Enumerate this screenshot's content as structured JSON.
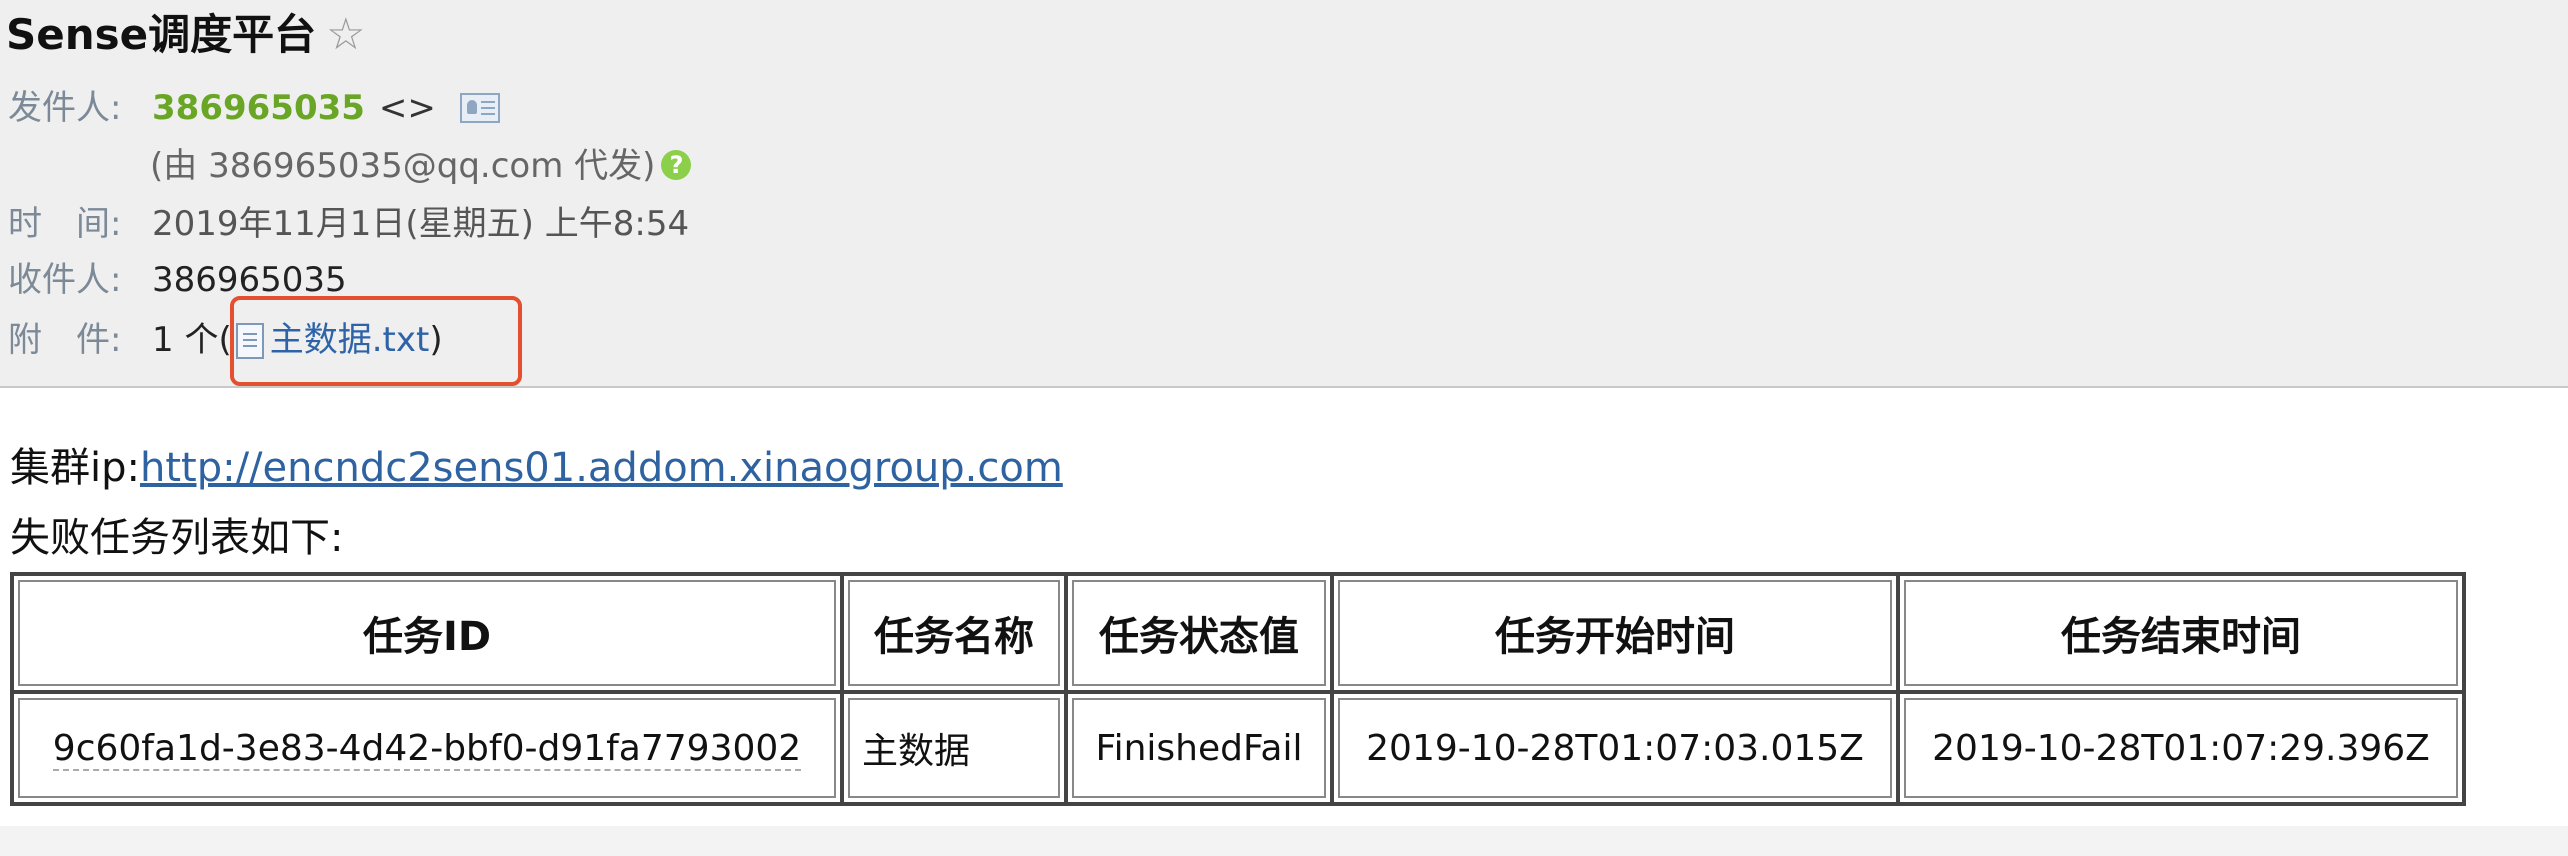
{
  "email": {
    "subject": "Sense调度平台",
    "star_icon": "☆",
    "sender": {
      "label": "发件人:",
      "name": "386965035",
      "addr": "<>",
      "proxy_note": "(由 386965035@qq.com 代发)",
      "help_icon": "?"
    },
    "time": {
      "label": "时　间:",
      "value": "2019年11月1日(星期五) 上午8:54"
    },
    "recipient": {
      "label": "收件人:",
      "value": "386965035"
    },
    "attachment": {
      "label": "附　件:",
      "count": "1 个",
      "open_paren": "(",
      "filename": "主数据.txt",
      "close_paren": ")"
    }
  },
  "body": {
    "cluster_label": "集群ip:",
    "cluster_url": "http://encndc2sens01.addom.xinaogroup.com",
    "list_intro": "失败任务列表如下:",
    "table": {
      "headers": [
        "任务ID",
        "任务名称",
        "任务状态值",
        "任务开始时间",
        "任务结束时间"
      ],
      "rows": [
        [
          "9c60fa1d-3e83-4d42-bbf0-d91fa7793002",
          "主数据",
          "FinishedFail",
          "2019-10-28T01:07:03.015Z",
          "2019-10-28T01:07:29.396Z"
        ]
      ]
    }
  },
  "colors": {
    "sender_name": "#6aa626",
    "link": "#2e62a0",
    "highlight_box": "#e34f2f",
    "header_bg": "#efefef"
  }
}
